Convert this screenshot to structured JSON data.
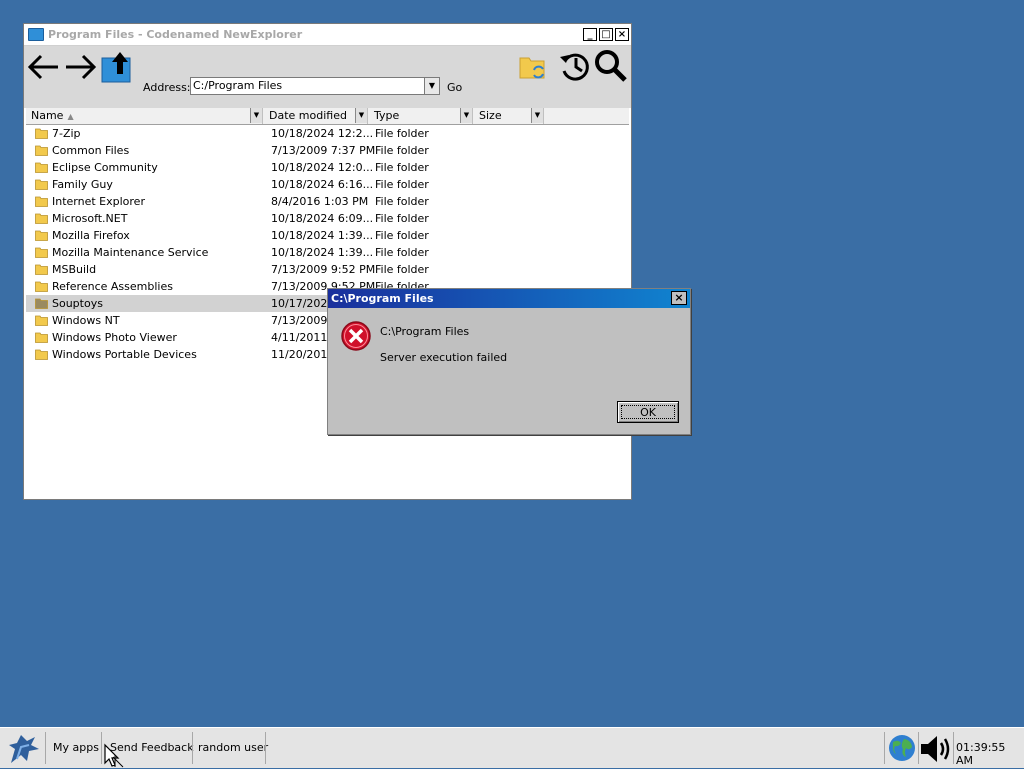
{
  "explorer": {
    "title": "Program Files - Codenamed NewExplorer",
    "caption_buttons": {
      "minimize": "_",
      "maximize": "□",
      "close": "×"
    },
    "address_label": "Address:",
    "address_value": "C:/Program Files",
    "go_label": "Go",
    "columns": {
      "name": "Name",
      "date": "Date modified",
      "type": "Type",
      "size": "Size"
    },
    "rows": [
      {
        "name": "7-Zip",
        "date": "10/18/2024 12:2...",
        "type": "File folder"
      },
      {
        "name": "Common Files",
        "date": "7/13/2009 7:37 PM",
        "type": "File folder"
      },
      {
        "name": "Eclipse Community",
        "date": "10/18/2024 12:0...",
        "type": "File folder"
      },
      {
        "name": "Family Guy",
        "date": "10/18/2024 6:16...",
        "type": "File folder"
      },
      {
        "name": "Internet Explorer",
        "date": "8/4/2016 1:03 PM",
        "type": "File folder"
      },
      {
        "name": "Microsoft.NET",
        "date": "10/18/2024 6:09...",
        "type": "File folder"
      },
      {
        "name": "Mozilla Firefox",
        "date": "10/18/2024 1:39...",
        "type": "File folder"
      },
      {
        "name": "Mozilla Maintenance Service",
        "date": "10/18/2024 1:39...",
        "type": "File folder"
      },
      {
        "name": "MSBuild",
        "date": "7/13/2009 9:52 PM",
        "type": "File folder"
      },
      {
        "name": "Reference Assemblies",
        "date": "7/13/2009 9:52 PM",
        "type": "File folder"
      },
      {
        "name": "Souptoys",
        "date": "10/17/2024 11:2...",
        "type": "File folder"
      },
      {
        "name": "Windows NT",
        "date": "7/13/2009 9",
        "type": ""
      },
      {
        "name": "Windows Photo Viewer",
        "date": "4/11/2011 7",
        "type": ""
      },
      {
        "name": "Windows Portable Devices",
        "date": "11/20/2010",
        "type": ""
      }
    ]
  },
  "dialog": {
    "title": "C:\\Program Files",
    "close": "×",
    "message_path": "C:\\Program Files",
    "message_error": "Server execution failed",
    "ok_label": "OK"
  },
  "taskbar": {
    "items": [
      "My apps",
      "Send Feedback",
      "random user"
    ],
    "clock": "01:39:55 AM"
  },
  "colors": {
    "desktop": "#3a6ea5",
    "dialog_title_start": "#1a2f9c",
    "dialog_title_end": "#1084d0",
    "error_red": "#d0102a",
    "folder_yellow": "#f2c94c"
  }
}
